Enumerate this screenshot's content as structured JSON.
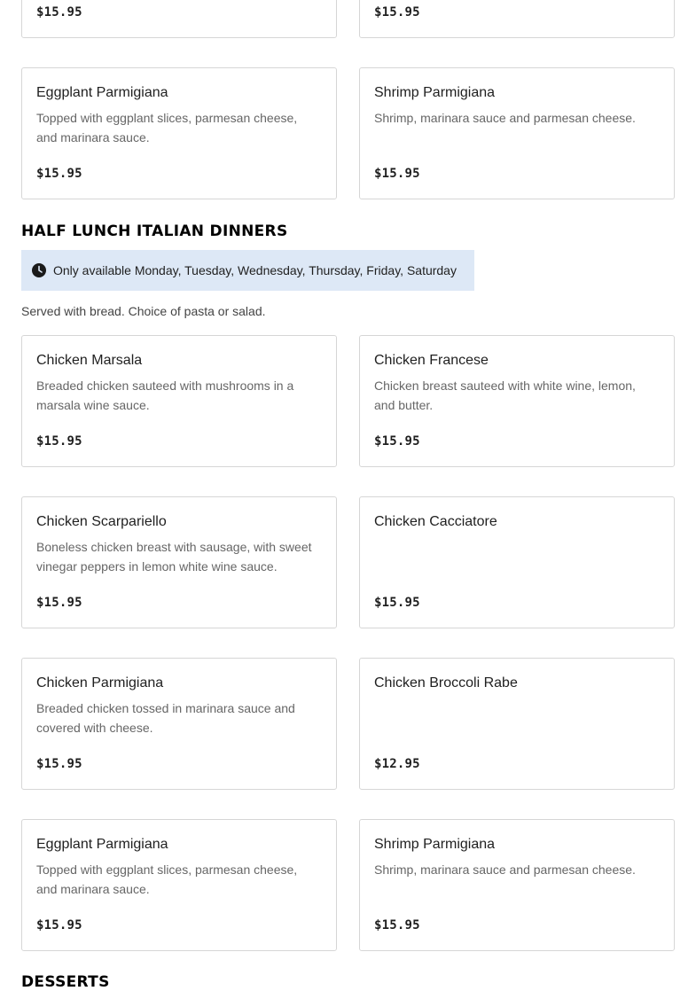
{
  "prev_section": {
    "partial_cards": [
      {
        "price": "$15.95"
      },
      {
        "price": "$15.95"
      }
    ],
    "cards": [
      {
        "name": "Eggplant Parmigiana",
        "description": "Topped with eggplant slices, parmesan cheese, and marinara sauce.",
        "price": "$15.95"
      },
      {
        "name": "Shrimp Parmigiana",
        "description": "Shrimp, marinara sauce and parmesan cheese.",
        "price": "$15.95"
      }
    ]
  },
  "half_lunch": {
    "title": "HALF LUNCH ITALIAN DINNERS",
    "availability": "Only available Monday, Tuesday, Wednesday, Thursday, Friday, Saturday",
    "availability_icon": "clock-icon",
    "note": "Served with bread. Choice of pasta or salad.",
    "cards": [
      {
        "name": "Chicken Marsala",
        "description": "Breaded chicken sauteed with mushrooms in a marsala wine sauce.",
        "price": "$15.95"
      },
      {
        "name": "Chicken Francese",
        "description": "Chicken breast sauteed with white wine, lemon, and butter.",
        "price": "$15.95"
      },
      {
        "name": "Chicken Scarpariello",
        "description": "Boneless chicken breast with sausage, with sweet vinegar peppers in lemon white wine sauce.",
        "price": "$15.95"
      },
      {
        "name": "Chicken Cacciatore",
        "description": "",
        "price": "$15.95"
      },
      {
        "name": "Chicken Parmigiana",
        "description": "Breaded chicken tossed in marinara sauce and covered with cheese.",
        "price": "$15.95"
      },
      {
        "name": "Chicken Broccoli Rabe",
        "description": "",
        "price": "$12.95"
      },
      {
        "name": "Eggplant Parmigiana",
        "description": "Topped with eggplant slices, parmesan cheese, and marinara sauce.",
        "price": "$15.95"
      },
      {
        "name": "Shrimp Parmigiana",
        "description": "Shrimp, marinara sauce and parmesan cheese.",
        "price": "$15.95"
      }
    ]
  },
  "desserts": {
    "title": "DESSERTS"
  }
}
